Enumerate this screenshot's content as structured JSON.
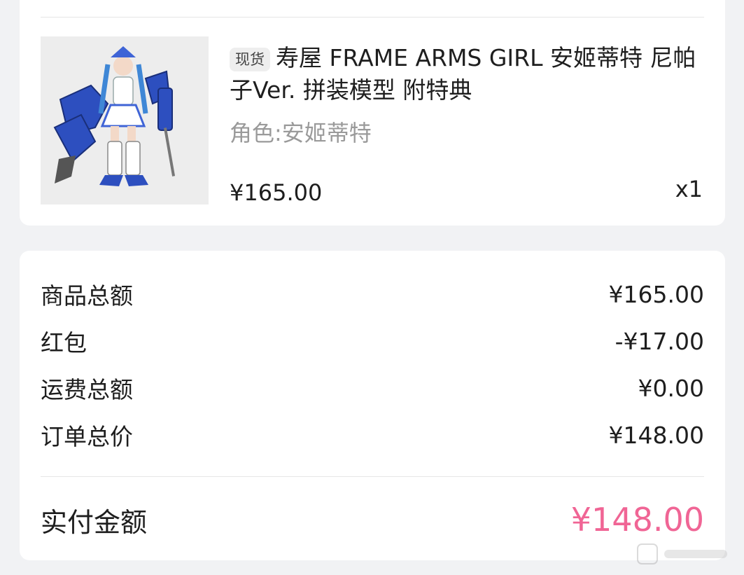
{
  "product": {
    "tag": "现货",
    "title": "寿屋 FRAME ARMS GIRL 安姬蒂特 尼帕子Ver. 拼装模型 附特典",
    "variant": "角色:安姬蒂特",
    "price": "¥165.00",
    "quantity": "x1",
    "image_desc": "figure-model-image"
  },
  "summary": {
    "rows": [
      {
        "label": "商品总额",
        "value": "¥165.00"
      },
      {
        "label": "红包",
        "value": "-¥17.00"
      },
      {
        "label": "运费总额",
        "value": "¥0.00"
      },
      {
        "label": "订单总价",
        "value": "¥148.00"
      }
    ],
    "paid_label": "实付金额",
    "paid_value": "¥148.00"
  },
  "colors": {
    "accent": "#f06595",
    "background": "#f1f2f4",
    "muted_text": "#9a9a9a"
  }
}
